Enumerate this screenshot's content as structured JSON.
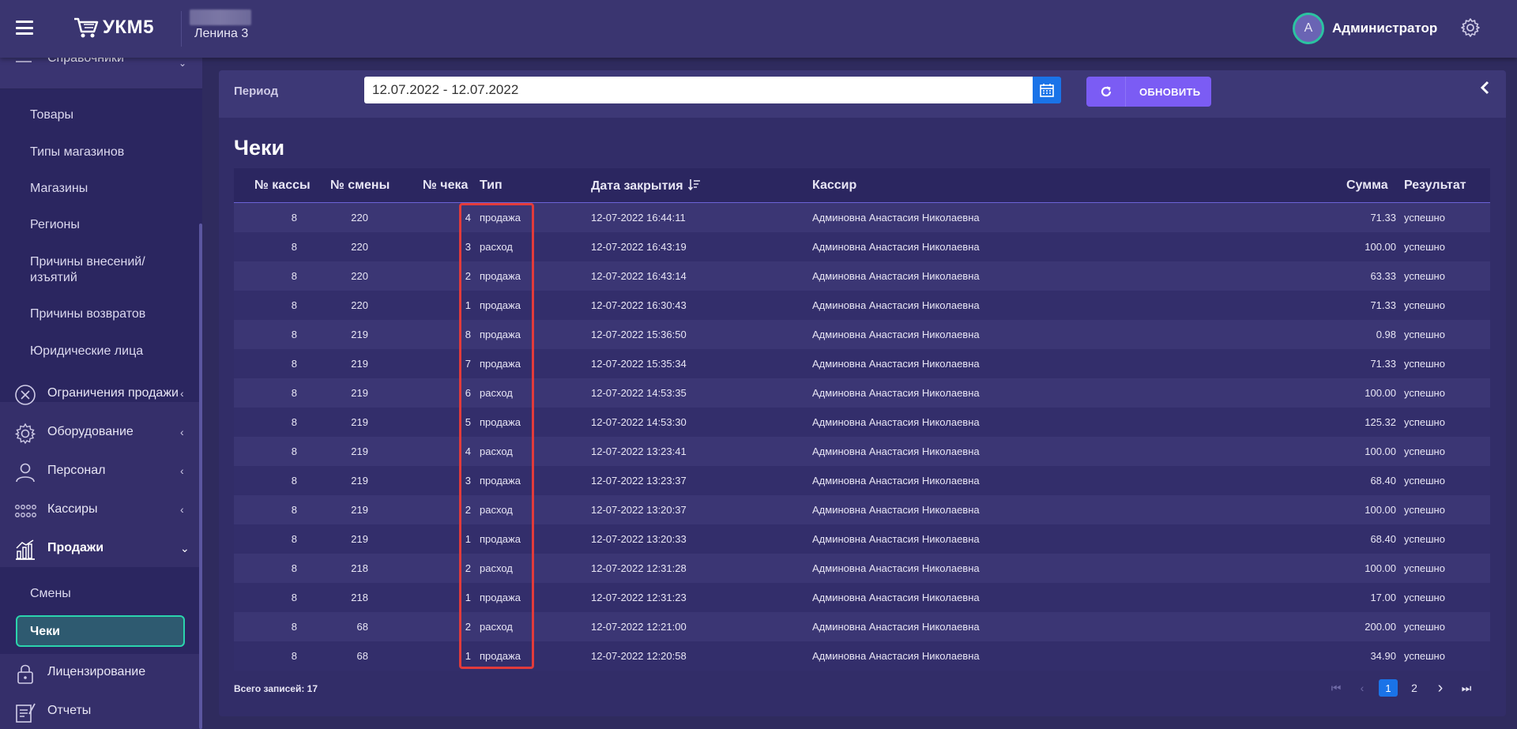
{
  "header": {
    "logo_text": "УКМ5",
    "store_name": "Ленина 3",
    "user_initial": "А",
    "user_name": "Администратор"
  },
  "sidebar": {
    "partial_top": "Справочники",
    "sub_items_top": [
      "Товары",
      "Типы магазинов",
      "Магазины",
      "Регионы",
      "Причины внесений/ изъятий",
      "Причины возвратов",
      "Юридические лица"
    ],
    "main_items": [
      {
        "label": "Ограничения продажи",
        "icon": "circle-x-icon"
      },
      {
        "label": "Оборудование",
        "icon": "gear-icon"
      },
      {
        "label": "Персонал",
        "icon": "person-icon"
      },
      {
        "label": "Кассиры",
        "icon": "dots-grid-icon"
      },
      {
        "label": "Продажи",
        "icon": "chart-icon"
      }
    ],
    "sales_sub": [
      "Смены",
      "Чеки"
    ],
    "bottom_items": [
      {
        "label": "Лицензирование",
        "icon": "lock-icon"
      },
      {
        "label": "Отчеты",
        "icon": "report-icon"
      }
    ]
  },
  "filter": {
    "period_label": "Период",
    "period_value": "12.07.2022 - 12.07.2022",
    "refresh_label": "ОБНОВИТЬ"
  },
  "page_title": "Чеки",
  "table": {
    "columns": [
      "№ кассы",
      "№ смены",
      "№ чека",
      "Тип",
      "Дата закрытия",
      "Кассир",
      "Сумма",
      "Результат"
    ],
    "rows": [
      [
        "8",
        "220",
        "4",
        "продажа",
        "12-07-2022 16:44:11",
        "Админовна Анастасия Николаевна",
        "71.33",
        "успешно"
      ],
      [
        "8",
        "220",
        "3",
        "расход",
        "12-07-2022 16:43:19",
        "Админовна Анастасия Николаевна",
        "100.00",
        "успешно"
      ],
      [
        "8",
        "220",
        "2",
        "продажа",
        "12-07-2022 16:43:14",
        "Админовна Анастасия Николаевна",
        "63.33",
        "успешно"
      ],
      [
        "8",
        "220",
        "1",
        "продажа",
        "12-07-2022 16:30:43",
        "Админовна Анастасия Николаевна",
        "71.33",
        "успешно"
      ],
      [
        "8",
        "219",
        "8",
        "продажа",
        "12-07-2022 15:36:50",
        "Админовна Анастасия Николаевна",
        "0.98",
        "успешно"
      ],
      [
        "8",
        "219",
        "7",
        "продажа",
        "12-07-2022 15:35:34",
        "Админовна Анастасия Николаевна",
        "71.33",
        "успешно"
      ],
      [
        "8",
        "219",
        "6",
        "расход",
        "12-07-2022 14:53:35",
        "Админовна Анастасия Николаевна",
        "100.00",
        "успешно"
      ],
      [
        "8",
        "219",
        "5",
        "продажа",
        "12-07-2022 14:53:30",
        "Админовна Анастасия Николаевна",
        "125.32",
        "успешно"
      ],
      [
        "8",
        "219",
        "4",
        "расход",
        "12-07-2022 13:23:41",
        "Админовна Анастасия Николаевна",
        "100.00",
        "успешно"
      ],
      [
        "8",
        "219",
        "3",
        "продажа",
        "12-07-2022 13:23:37",
        "Админовна Анастасия Николаевна",
        "68.40",
        "успешно"
      ],
      [
        "8",
        "219",
        "2",
        "расход",
        "12-07-2022 13:20:37",
        "Админовна Анастасия Николаевна",
        "100.00",
        "успешно"
      ],
      [
        "8",
        "219",
        "1",
        "продажа",
        "12-07-2022 13:20:33",
        "Админовна Анастасия Николаевна",
        "68.40",
        "успешно"
      ],
      [
        "8",
        "218",
        "2",
        "расход",
        "12-07-2022 12:31:28",
        "Админовна Анастасия Николаевна",
        "100.00",
        "успешно"
      ],
      [
        "8",
        "218",
        "1",
        "продажа",
        "12-07-2022 12:31:23",
        "Админовна Анастасия Николаевна",
        "17.00",
        "успешно"
      ],
      [
        "8",
        "68",
        "2",
        "расход",
        "12-07-2022 12:21:00",
        "Админовна Анастасия Николаевна",
        "200.00",
        "успешно"
      ],
      [
        "8",
        "68",
        "1",
        "продажа",
        "12-07-2022 12:20:58",
        "Админовна Анастасия Николаевна",
        "34.90",
        "успешно"
      ]
    ]
  },
  "footer": {
    "total_label": "Всего записей: 17",
    "pages": [
      "1",
      "2"
    ]
  },
  "colors": {
    "accent": "#7b5cf4",
    "active_page": "#1a73e8",
    "highlight": "#e23b3b",
    "active_border": "#2bd4ad"
  }
}
